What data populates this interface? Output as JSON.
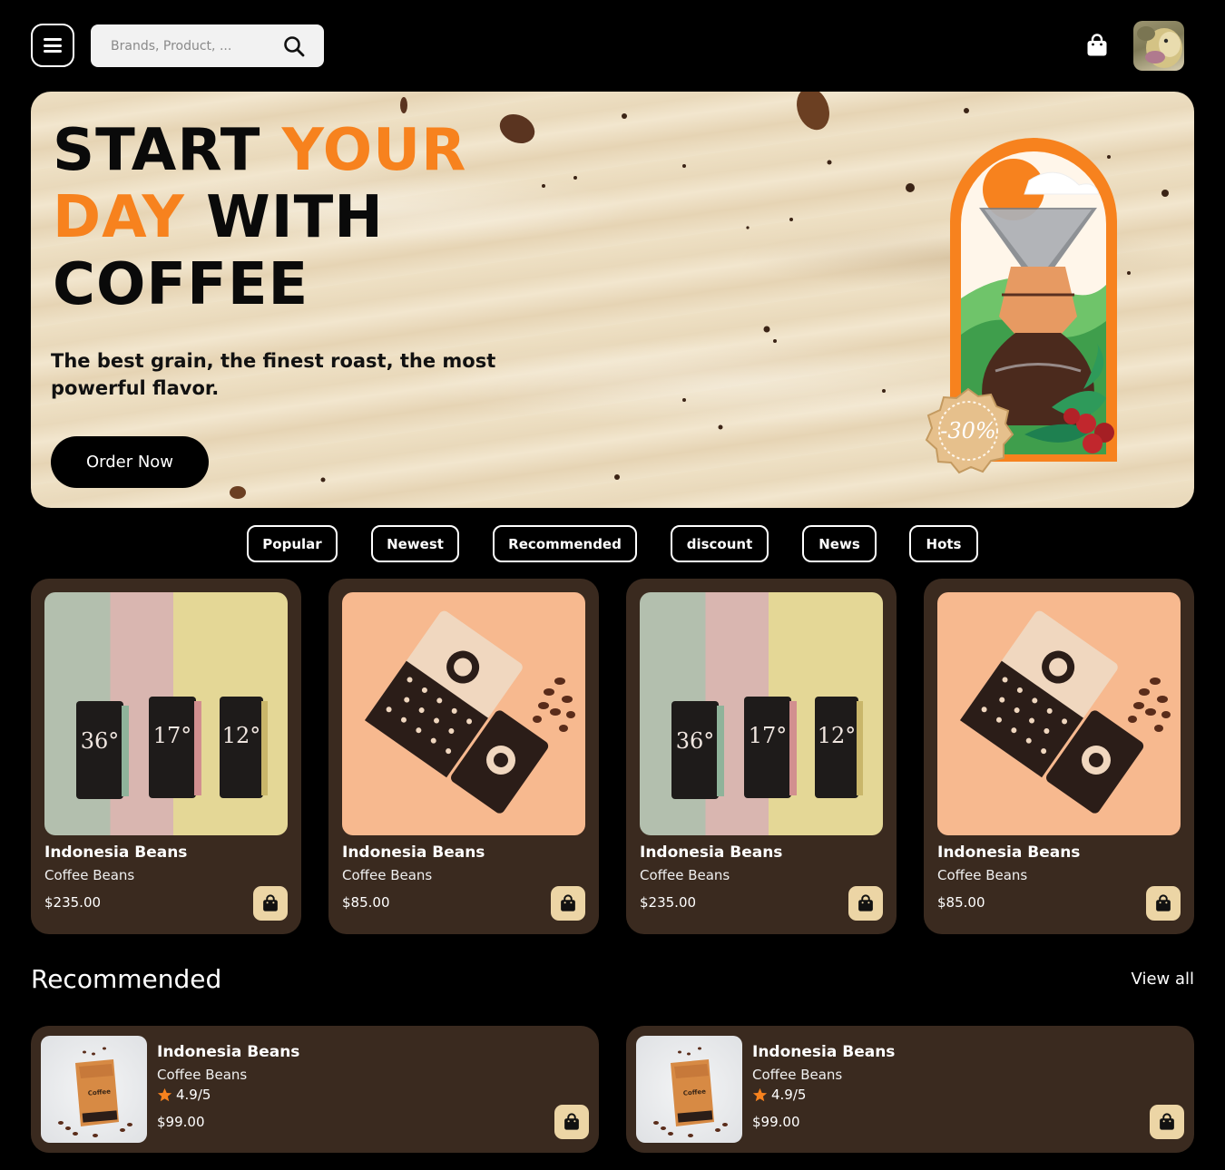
{
  "header": {
    "search_placeholder": "Brands, Product, ...",
    "icons": {
      "menu": "hamburger-icon",
      "search": "search-icon",
      "cart": "shopping-bag-icon",
      "avatar": "user-avatar"
    }
  },
  "hero": {
    "title_line1_a": "START ",
    "title_line1_b": "YOUR",
    "title_line2_a": "DAY",
    "title_line2_b": " WITH",
    "title_line3": "COFFEE",
    "subtitle": "The best grain, the finest roast, the most powerful flavor.",
    "cta": "Order Now",
    "badge": "-30%"
  },
  "filters": [
    "Popular",
    "Newest",
    "Recommended",
    "discount",
    "News",
    "Hots"
  ],
  "products": [
    {
      "name": "Indonesia Beans",
      "category": "Coffee Beans",
      "price": "$235.00",
      "image": "three-coffee-bags"
    },
    {
      "name": "Indonesia Beans",
      "category": "Coffee Beans",
      "price": "$85.00",
      "image": "coffee-bag-and-cup"
    },
    {
      "name": "Indonesia Beans",
      "category": "Coffee Beans",
      "price": "$235.00",
      "image": "three-coffee-bags"
    },
    {
      "name": "Indonesia Beans",
      "category": "Coffee Beans",
      "price": "$85.00",
      "image": "coffee-bag-and-cup"
    }
  ],
  "recommended": {
    "title": "Recommended",
    "view_all": "View all",
    "items": [
      {
        "name": "Indonesia Beans",
        "category": "Coffee Beans",
        "rating": "4.9/5",
        "price": "$99.00"
      },
      {
        "name": "Indonesia Beans",
        "category": "Coffee Beans",
        "rating": "4.9/5",
        "price": "$99.00"
      }
    ]
  },
  "colors": {
    "accent": "#f7821e",
    "card_bg": "#3a2a1f",
    "bag_button": "#ecd5a5",
    "background": "#000000"
  }
}
